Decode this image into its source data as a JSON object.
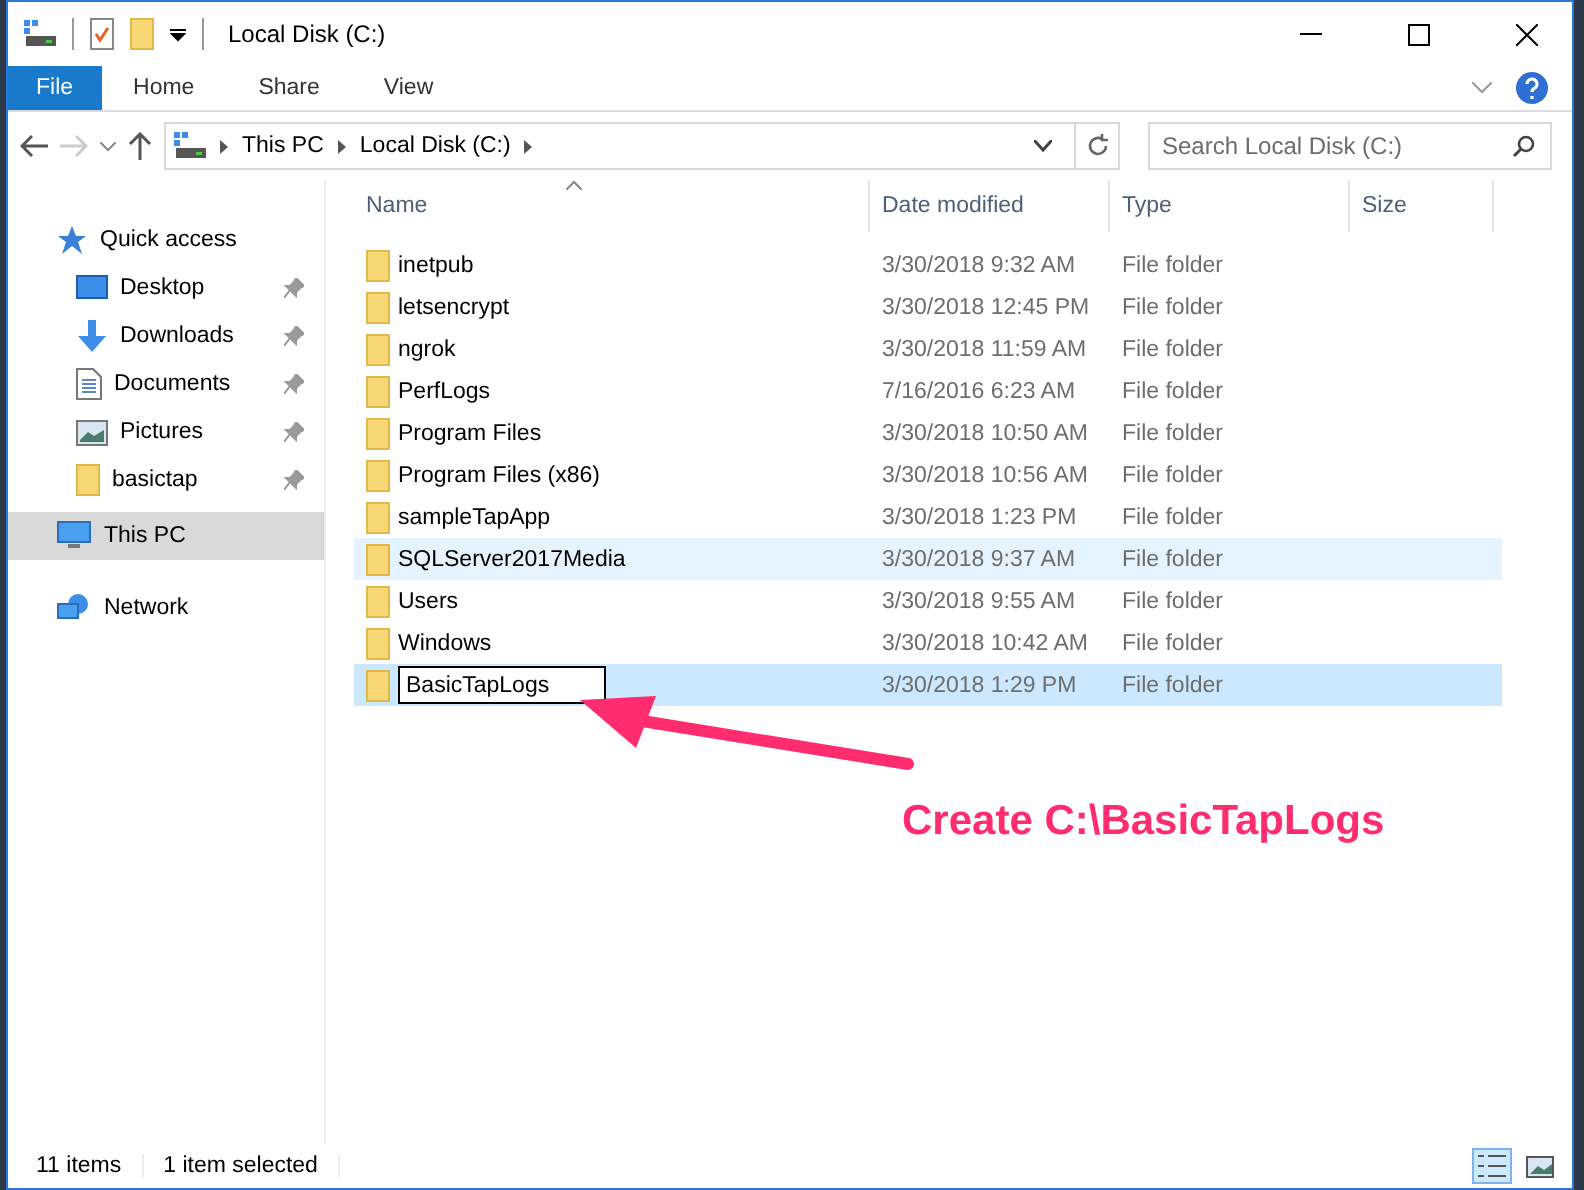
{
  "window": {
    "title": "Local Disk (C:)"
  },
  "ribbon_tabs": [
    {
      "label": "File",
      "selected": true
    },
    {
      "label": "Home",
      "selected": false
    },
    {
      "label": "Share",
      "selected": false
    },
    {
      "label": "View",
      "selected": false
    }
  ],
  "address": {
    "crumbs": [
      "This PC",
      "Local Disk (C:)"
    ]
  },
  "search": {
    "placeholder": "Search Local Disk (C:)"
  },
  "sidebar": {
    "items": [
      {
        "label": "Quick access",
        "kind": "quick",
        "selected": false,
        "children": [
          {
            "label": "Desktop",
            "kind": "desktop",
            "pinned": true,
            "selected": false
          },
          {
            "label": "Downloads",
            "kind": "downloads",
            "pinned": true,
            "selected": false
          },
          {
            "label": "Documents",
            "kind": "documents",
            "pinned": true,
            "selected": false
          },
          {
            "label": "Pictures",
            "kind": "pictures",
            "pinned": true,
            "selected": false
          },
          {
            "label": "basictap",
            "kind": "folder",
            "pinned": true,
            "selected": false
          }
        ]
      },
      {
        "label": "This PC",
        "kind": "pc",
        "selected": true
      },
      {
        "label": "Network",
        "kind": "network",
        "selected": false
      }
    ]
  },
  "table": {
    "columns": [
      "Name",
      "Date modified",
      "Type",
      "Size"
    ],
    "rows": [
      {
        "name": "inetpub",
        "date": "3/30/2018 9:32 AM",
        "type": "File folder",
        "selected": false,
        "hovered": false,
        "editing": false
      },
      {
        "name": "letsencrypt",
        "date": "3/30/2018 12:45 PM",
        "type": "File folder",
        "selected": false,
        "hovered": false,
        "editing": false
      },
      {
        "name": "ngrok",
        "date": "3/30/2018 11:59 AM",
        "type": "File folder",
        "selected": false,
        "hovered": false,
        "editing": false
      },
      {
        "name": "PerfLogs",
        "date": "7/16/2016 6:23 AM",
        "type": "File folder",
        "selected": false,
        "hovered": false,
        "editing": false
      },
      {
        "name": "Program Files",
        "date": "3/30/2018 10:50 AM",
        "type": "File folder",
        "selected": false,
        "hovered": false,
        "editing": false
      },
      {
        "name": "Program Files (x86)",
        "date": "3/30/2018 10:56 AM",
        "type": "File folder",
        "selected": false,
        "hovered": false,
        "editing": false
      },
      {
        "name": "sampleTapApp",
        "date": "3/30/2018 1:23 PM",
        "type": "File folder",
        "selected": false,
        "hovered": false,
        "editing": false
      },
      {
        "name": "SQLServer2017Media",
        "date": "3/30/2018 9:37 AM",
        "type": "File folder",
        "selected": false,
        "hovered": true,
        "editing": false
      },
      {
        "name": "Users",
        "date": "3/30/2018 9:55 AM",
        "type": "File folder",
        "selected": false,
        "hovered": false,
        "editing": false
      },
      {
        "name": "Windows",
        "date": "3/30/2018 10:42 AM",
        "type": "File folder",
        "selected": false,
        "hovered": false,
        "editing": false
      },
      {
        "name": "BasicTapLogs",
        "date": "3/30/2018 1:29 PM",
        "type": "File folder",
        "selected": true,
        "hovered": false,
        "editing": true
      }
    ]
  },
  "annotation": {
    "text": "Create C:\\BasicTapLogs"
  },
  "status_bar": {
    "item_count": "11 items",
    "selection": "1 item selected",
    "views": [
      {
        "kind": "details",
        "selected": true
      },
      {
        "kind": "thumbnails",
        "selected": false
      }
    ]
  }
}
